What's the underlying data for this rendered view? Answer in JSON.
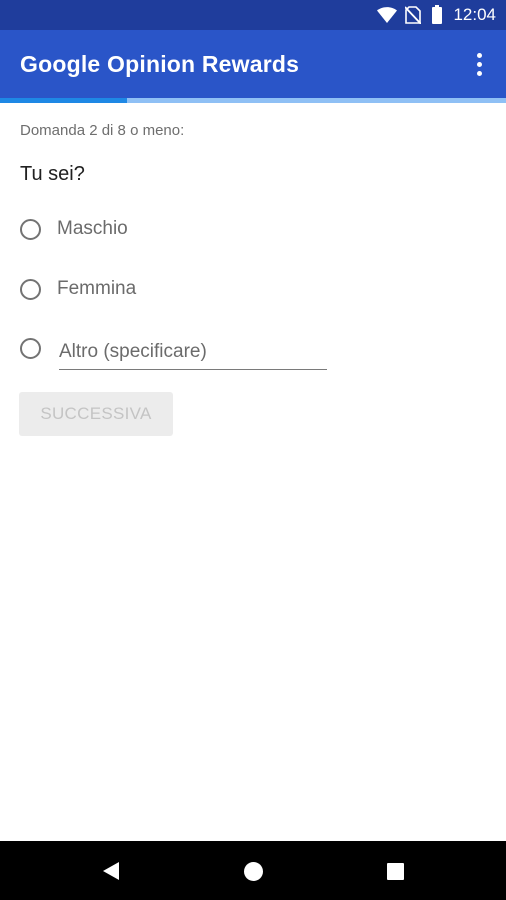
{
  "status_bar": {
    "time": "12:04",
    "icons": [
      "wifi-icon",
      "no-sim-icon",
      "battery-icon"
    ]
  },
  "app_bar": {
    "title": "Google Opinion Rewards",
    "menu_icon": "more-vert-icon"
  },
  "progress": {
    "fraction": 0.25
  },
  "survey": {
    "counter": "Domanda 2 di 8 o meno:",
    "question": "Tu sei?",
    "options": [
      {
        "label": "Maschio"
      },
      {
        "label": "Femmina"
      }
    ],
    "other": {
      "placeholder": "Altro (specificare)",
      "value": ""
    },
    "next_label": "SUCCESSIVA"
  },
  "nav_bar": {
    "icons": [
      "back-icon",
      "home-icon",
      "recents-icon"
    ]
  },
  "colors": {
    "status_bar": "#1f3d9c",
    "app_bar": "#2a55c8",
    "progress_fill": "#1e88e5",
    "progress_track": "#8fc0f5"
  }
}
